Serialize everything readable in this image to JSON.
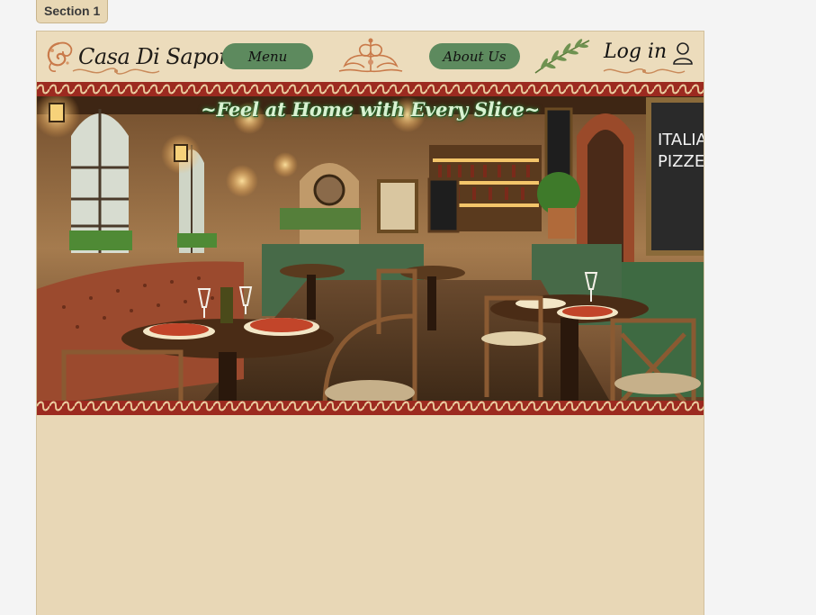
{
  "section": {
    "label": "Section 1"
  },
  "header": {
    "brand": "Casa Di Sapore",
    "menu_label": "Menu",
    "about_label": "About Us",
    "login_label": "Log in",
    "icons": [
      "flourish-logo-icon",
      "ornament-icon",
      "olive-branch-icon",
      "user-icon"
    ]
  },
  "hero": {
    "tagline": "~Feel at Home with Every Slice~",
    "chalkboard_text": "ITALIAN PIZZERIA",
    "image_desc_icons": [
      "restaurant-interior-image"
    ]
  },
  "colors": {
    "page_bg": "#f4f4f4",
    "frame_bg": "#e8d7b6",
    "button_green": "#5d8a5e",
    "tagline_green": "#d9f2d2",
    "border_red": "#9c2a20"
  }
}
